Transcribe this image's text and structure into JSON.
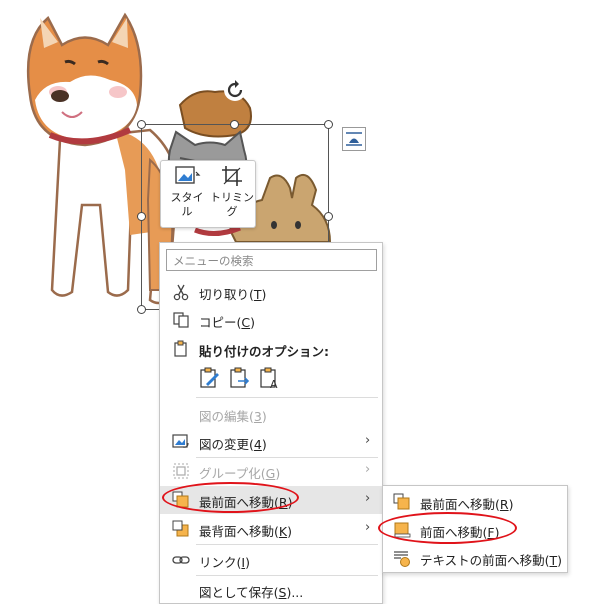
{
  "mini_toolbar": {
    "style_label_1": "スタイ",
    "style_label_2": "ル",
    "trim_label": "トリミング"
  },
  "context_menu": {
    "search_placeholder": "メニューの検索",
    "cut": {
      "text": "切り取り(",
      "key": "T",
      "end": ")"
    },
    "copy": {
      "text": "コピー(",
      "key": "C",
      "end": ")"
    },
    "paste_options": "貼り付けのオプション:",
    "edit_picture": {
      "text": "図の編集(",
      "key": "3",
      "end": ")"
    },
    "change_picture": {
      "text": "図の変更(",
      "key": "4",
      "end": ")"
    },
    "group": {
      "text": "グループ化(",
      "key": "G",
      "end": ")"
    },
    "bring_to_front": {
      "text": "最前面へ移動(",
      "key": "R",
      "end": ")"
    },
    "send_to_back": {
      "text": "最背面へ移動(",
      "key": "K",
      "end": ")"
    },
    "link": {
      "text": "リンク(",
      "key": "I",
      "end": ")"
    },
    "save_as_picture": {
      "text": "図として保存(",
      "key": "S",
      "end": ")..."
    },
    "submenu_arrow": "›"
  },
  "submenu": {
    "bring_to_front": {
      "text": "最前面へ移動(",
      "key": "R",
      "end": ")"
    },
    "bring_forward": {
      "text": "前面へ移動(",
      "key": "F",
      "end": ")"
    },
    "in_front_of_text": {
      "text": "テキストの前面へ移動(",
      "key": "T",
      "end": ")"
    }
  },
  "colors": {
    "accent_red": "#e0131a",
    "icon_orange": "#f6b44c",
    "icon_blue": "#2f7dd1",
    "hover_gray": "#e6e6e6"
  }
}
